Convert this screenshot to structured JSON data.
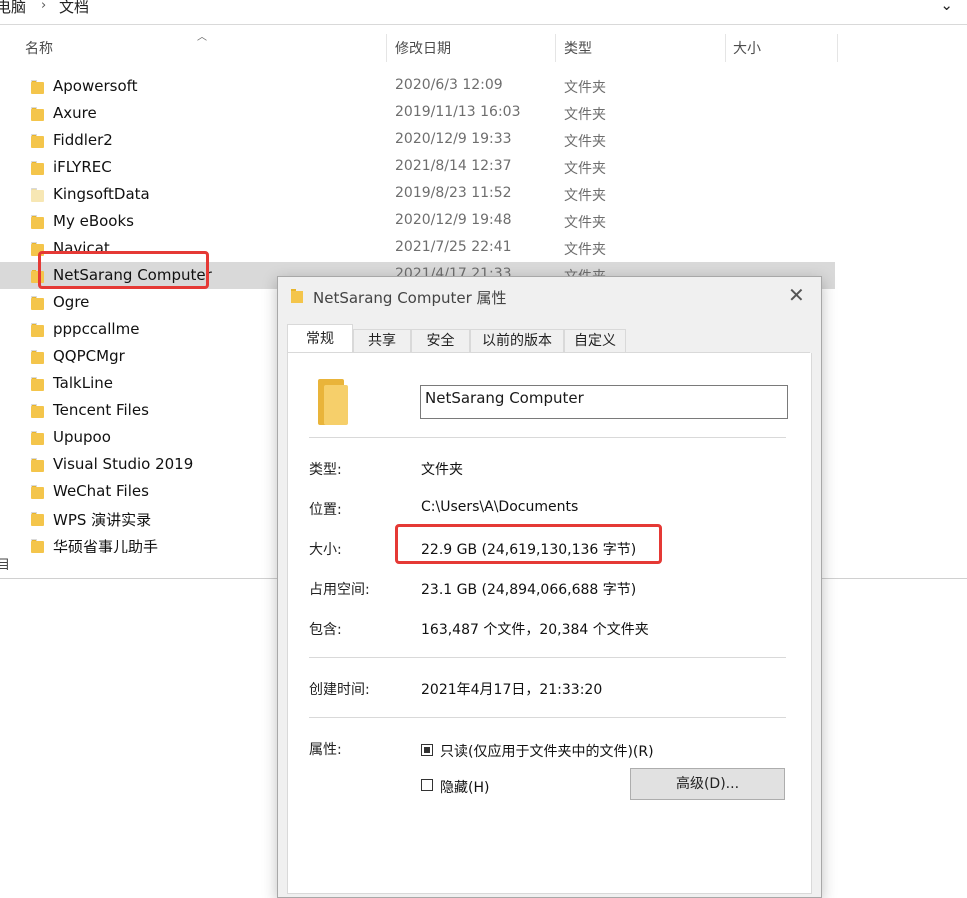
{
  "breadcrumb": {
    "parent": "电脑",
    "current": "文档"
  },
  "columns": {
    "name": "名称",
    "modified": "修改日期",
    "type": "类型",
    "size": "大小"
  },
  "files": [
    {
      "name": "Apowersoft",
      "modified": "2020/6/3 12:09",
      "type": "文件夹"
    },
    {
      "name": "Axure",
      "modified": "2019/11/13 16:03",
      "type": "文件夹"
    },
    {
      "name": "Fiddler2",
      "modified": "2020/12/9 19:33",
      "type": "文件夹"
    },
    {
      "name": "iFLYREC",
      "modified": "2021/8/14 12:37",
      "type": "文件夹"
    },
    {
      "name": "KingsoftData",
      "modified": "2019/8/23 11:52",
      "type": "文件夹"
    },
    {
      "name": "My eBooks",
      "modified": "2020/12/9 19:48",
      "type": "文件夹"
    },
    {
      "name": "Navicat",
      "modified": "2021/7/25 22:41",
      "type": "文件夹"
    },
    {
      "name": "NetSarang Computer",
      "modified": "2021/4/17 21:33",
      "type": "文件夹"
    },
    {
      "name": "Ogre",
      "modified": "",
      "type": ""
    },
    {
      "name": "pppccallme",
      "modified": "",
      "type": ""
    },
    {
      "name": "QQPCMgr",
      "modified": "",
      "type": ""
    },
    {
      "name": "TalkLine",
      "modified": "",
      "type": ""
    },
    {
      "name": "Tencent Files",
      "modified": "",
      "type": ""
    },
    {
      "name": "Upupoo",
      "modified": "",
      "type": ""
    },
    {
      "name": "Visual Studio 2019",
      "modified": "",
      "type": ""
    },
    {
      "name": "WeChat Files",
      "modified": "",
      "type": ""
    },
    {
      "name": "WPS 演讲实录",
      "modified": "",
      "type": ""
    },
    {
      "name": "华硕省事儿助手",
      "modified": "",
      "type": ""
    }
  ],
  "left_edge_glyph": "目",
  "dialog": {
    "title": "NetSarang Computer 属性",
    "close_glyph": "✕",
    "tabs": [
      "常规",
      "共享",
      "安全",
      "以前的版本",
      "自定义"
    ],
    "folder_name": "NetSarang Computer",
    "props": {
      "type_label": "类型:",
      "type_value": "文件夹",
      "location_label": "位置:",
      "location_value": "C:\\Users\\A\\Documents",
      "size_label": "大小:",
      "size_value": "22.9 GB (24,619,130,136 字节)",
      "disk_label": "占用空间:",
      "disk_value": "23.1 GB (24,894,066,688 字节)",
      "contains_label": "包含:",
      "contains_value": "163,487 个文件，20,384 个文件夹",
      "created_label": "创建时间:",
      "created_value": "2021年4月17日，21:33:20",
      "attr_label": "属性:",
      "readonly_label": "只读(仅应用于文件夹中的文件)(R)",
      "hidden_label": "隐藏(H)",
      "advanced_button": "高级(D)..."
    }
  },
  "colors": {
    "highlight": "#e53935",
    "folder": "#f4c54b",
    "selected_row": "#d9d9d9"
  }
}
